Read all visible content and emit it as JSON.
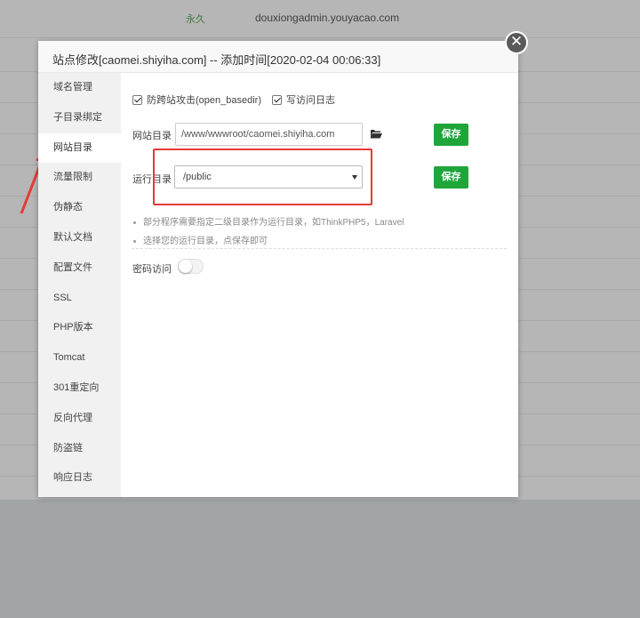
{
  "background": {
    "expiry": "永久",
    "admin_domain": "douxiongadmin.youyacao.com"
  },
  "modal": {
    "title": "站点修改[caomei.shiyiha.com] -- 添加时间[2020-02-04 00:06:33]",
    "close_label": "✕"
  },
  "sidebar": {
    "items": [
      {
        "label": "域名管理"
      },
      {
        "label": "子目录绑定"
      },
      {
        "label": "网站目录",
        "active": true
      },
      {
        "label": "流量限制"
      },
      {
        "label": "伪静态"
      },
      {
        "label": "默认文档"
      },
      {
        "label": "配置文件"
      },
      {
        "label": "SSL"
      },
      {
        "label": "PHP版本"
      },
      {
        "label": "Tomcat"
      },
      {
        "label": "301重定向"
      },
      {
        "label": "反向代理"
      },
      {
        "label": "防盗链"
      },
      {
        "label": "响应日志"
      }
    ]
  },
  "content": {
    "checkbox_basedir": {
      "label": "防跨站攻击(open_basedir)",
      "checked": true
    },
    "checkbox_log": {
      "label": "写访问日志",
      "checked": true
    },
    "site_dir": {
      "label": "网站目录",
      "value": "/www/wwwroot/caomei.shiyiha.com"
    },
    "save_label": "保存",
    "run_dir": {
      "label": "运行目录",
      "selected": "/public"
    },
    "tips": [
      "部分程序需要指定二级目录作为运行目录，如ThinkPHP5，Laravel",
      "选择您的运行目录，点保存即可"
    ],
    "password_access": {
      "label": "密码访问",
      "enabled": false
    }
  },
  "colors": {
    "accent_green": "#20a53a",
    "highlight_red": "#e53a3a"
  },
  "icons": {
    "folder": "folder-open-icon",
    "close": "close-icon",
    "caret": "caret-down-icon",
    "annotation_arrow": "red-arrow-icon"
  }
}
